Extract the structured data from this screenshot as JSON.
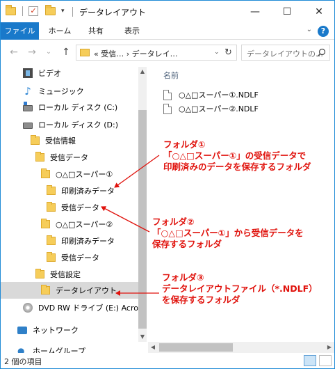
{
  "window": {
    "title": "データレイアウト",
    "controls": {
      "minimize": "—",
      "maximize": "☐",
      "close": "✕"
    }
  },
  "ribbon": {
    "tabs": [
      "ファイル",
      "ホーム",
      "共有",
      "表示"
    ],
    "help": "?"
  },
  "nav": {
    "back": "←",
    "forward": "→",
    "recent": "⌄",
    "up": "↑",
    "address": "« 受信… › データレイ…",
    "search_placeholder": "データレイアウトの…"
  },
  "sidebar": {
    "items": [
      {
        "label": "ビデオ",
        "icon": "video-icon"
      },
      {
        "label": "ミュージック",
        "icon": "music-icon"
      },
      {
        "label": "ローカル ディスク (C:)",
        "icon": "drive-icon"
      },
      {
        "label": "ローカル ディスク (D:)",
        "icon": "drive-icon"
      },
      {
        "label": "受信情報",
        "icon": "folder-icon"
      },
      {
        "label": "受信データ",
        "icon": "folder-icon"
      },
      {
        "label": "○△□スーパー①",
        "icon": "folder-icon"
      },
      {
        "label": "印刷済みデータ",
        "icon": "folder-icon"
      },
      {
        "label": "受信データ",
        "icon": "folder-icon"
      },
      {
        "label": "○△□スーパー②",
        "icon": "folder-icon"
      },
      {
        "label": "印刷済みデータ",
        "icon": "folder-icon"
      },
      {
        "label": "受信データ",
        "icon": "folder-icon"
      },
      {
        "label": "受信設定",
        "icon": "folder-icon"
      },
      {
        "label": "データレイアウト",
        "icon": "folder-icon",
        "selected": true
      },
      {
        "label": "DVD RW ドライブ (E:) Acronis",
        "icon": "dvd-icon"
      },
      {
        "label": "ネットワーク",
        "icon": "network-icon"
      },
      {
        "label": "ホームグループ",
        "icon": "homegroup-icon"
      }
    ]
  },
  "main": {
    "column_header": "名前",
    "files": [
      {
        "name": "○△□スーパー①.NDLF"
      },
      {
        "name": "○△□スーパー②.NDLF"
      }
    ]
  },
  "status": {
    "item_count": "2 個の項目"
  },
  "annotations": {
    "a1": [
      "フォルダ①",
      "「○△□スーパー①」の受信データで",
      "印刷済みのデータを保存するフォルダ"
    ],
    "a2": [
      "フォルダ②",
      "「○△□スーパー①」から受信データを",
      "保存するフォルダ"
    ],
    "a3": [
      "フォルダ③",
      "データレイアウトファイル（*.NDLF）",
      "を保存するフォルダ"
    ]
  },
  "colors": {
    "accent": "#1979ca",
    "annotation": "#e0120c",
    "folder": "#f6cd5a",
    "selection": "#d9d9d9"
  }
}
